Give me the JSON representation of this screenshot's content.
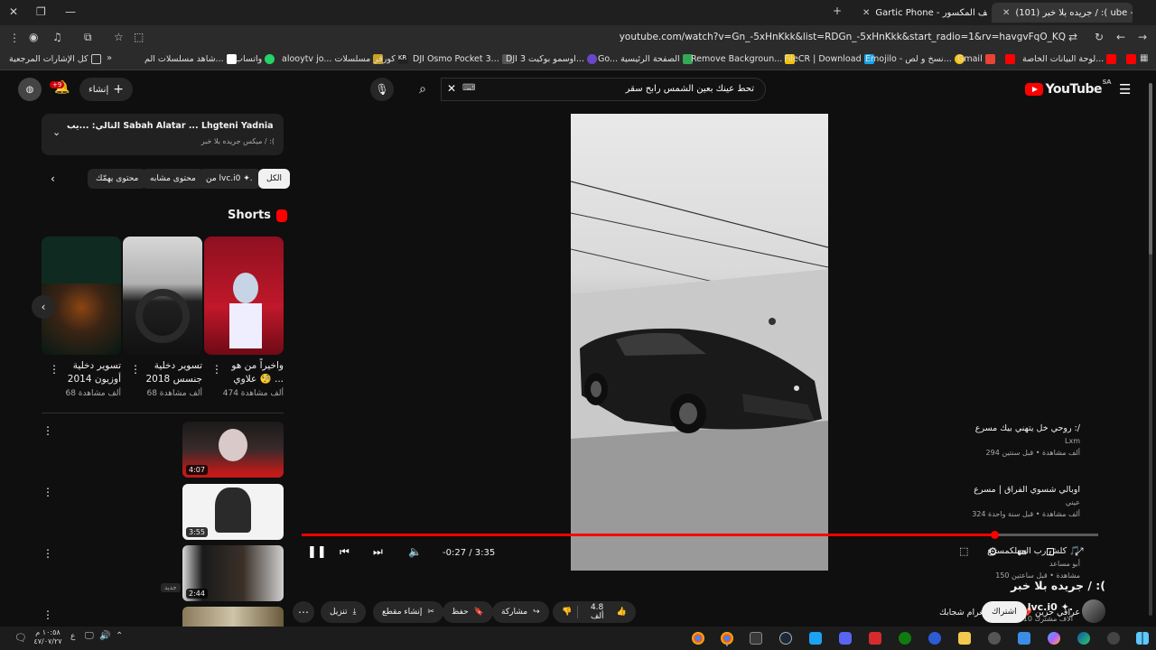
{
  "browser": {
    "tabs": [
      {
        "label": "(101) جريده بلا خبر / :( ube -",
        "active": true
      },
      {
        "label": "Gartic Phone - الهاتف المكسور",
        "active": false
      }
    ],
    "url": "youtube.com/watch?v=Gn_-5xHnKkk&list=RDGn_-5xHnKkk&start_radio=1&rv=havgvFqO_KQ",
    "bookmarks": [
      "كل الإشارات المرجعية",
      "شاهد مسلسلات الم...",
      "واتساب",
      "alooytv jo... مسلسلات",
      "كورقر",
      "DJI Osmo Pocket 3...",
      "DJI اوسمو بوكيت 3...",
      "Go... الصفحة الرئيسية",
      "Remove Backgroun...",
      "FileCR | Download",
      "Emojilo - نسخ و لص...",
      "Gmail",
      "لوحة البيانات الخاصة..."
    ]
  },
  "youtube": {
    "logo": "YouTube",
    "region": "SA",
    "search_value": "تحط عينك بعين الشمس رابح سقر",
    "create_label": "إنشاء",
    "notif_badge": "+9"
  },
  "sidebar": {
    "mix": {
      "title": "التالي: ...يب Sabah Alatar ... Lhgteni Yadnia - Video Clip |",
      "subtitle": "ميكس جريده بلا خبر / :("
    },
    "chips": [
      "الكل",
      "من lvc.i0 ✦.",
      "محتوى مشابه",
      "محتوى يهمّك"
    ],
    "shorts_heading": "Shorts",
    "shorts": [
      {
        "title": "واخيراً من هو علاوي 🧐 ...",
        "views": "474 ألف مشاهدة"
      },
      {
        "title": "تسوير دخلية جنسس 2018",
        "views": "68 ألف مشاهدة"
      },
      {
        "title": "تسوير دخلية أوزيون 2014",
        "views": "68 ألف مشاهدة"
      }
    ],
    "videos": [
      {
        "title": "روحي خل يتهني بيك مسرع :/",
        "channel": "Lxm",
        "meta": "294 ألف مشاهدة • قبل سنتين",
        "duration": "4:07"
      },
      {
        "title": "اوبالي شسوي الفراق | مسرع",
        "channel": "عيني",
        "meta": "324 ألف مشاهدة • قبل سنة واحدة",
        "duration": "3:55"
      },
      {
        "title": "كلش رب المهلكمسرع 🎵",
        "channel": "أبو مساعد",
        "meta": "150 مشاهدة • قبل ساعتين",
        "duration": "2:44",
        "badge": "جديد"
      },
      {
        "title": "عراقي حزين 💔 | و على الغرام شجابك ,",
        "channel": "",
        "meta": "",
        "duration": ""
      }
    ]
  },
  "player": {
    "time_display": "-0:27 / 3:35",
    "progress_fraction": 0.87
  },
  "video": {
    "title": "جريده بلا خبر / :(",
    "channel": "lvc.i0 ✦.",
    "subscribers": "10 آلاف مشترك",
    "subscribe_label": "اشتراك",
    "likes": "4.8 ألف",
    "share_label": "مشاركة",
    "save_label": "حفظ",
    "clip_label": "إنشاء مقطع",
    "download_label": "تنزيل"
  },
  "taskbar": {
    "time": "١٠:٥٨ م",
    "date": "٤٧/٠٧/٢٧"
  }
}
